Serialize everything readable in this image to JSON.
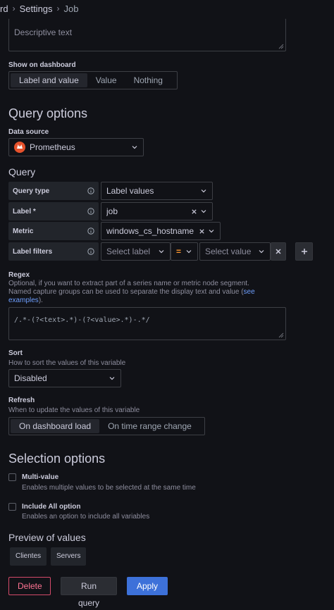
{
  "breadcrumb": {
    "part1": "rd",
    "part2": "Settings",
    "part3": "Job"
  },
  "description": {
    "placeholder": "Descriptive text"
  },
  "show_on_dashboard": {
    "label": "Show on dashboard",
    "options": [
      "Label and value",
      "Value",
      "Nothing"
    ],
    "selected": "Label and value"
  },
  "query_options": {
    "title": "Query options",
    "data_source_label": "Data source",
    "data_source": "Prometheus"
  },
  "query": {
    "title": "Query",
    "rows": [
      {
        "label": "Query type",
        "value": "Label values"
      },
      {
        "label": "Label *",
        "value": "job"
      },
      {
        "label": "Metric",
        "value": "windows_cs_hostname"
      },
      {
        "label": "Label filters"
      }
    ],
    "filter": {
      "label_placeholder": "Select label",
      "operator": "=",
      "value_placeholder": "Select value"
    }
  },
  "regex": {
    "label": "Regex",
    "desc_line1": "Optional, if you want to extract part of a series name or metric node segment.",
    "desc_line2": "Named capture groups can be used to separate the display text and value (",
    "desc_link1": "see",
    "desc_link2": "examples",
    "desc_end": ").",
    "value": "/.*-(?<text>.*)-(?<value>.*)-.*/"
  },
  "sort": {
    "label": "Sort",
    "desc": "How to sort the values of this variable",
    "value": "Disabled"
  },
  "refresh": {
    "label": "Refresh",
    "desc": "When to update the values of this variable",
    "options": [
      "On dashboard load",
      "On time range change"
    ],
    "selected": "On dashboard load"
  },
  "selection_options": {
    "title": "Selection options",
    "multi_value": {
      "label": "Multi-value",
      "desc": "Enables multiple values to be selected at the same time",
      "checked": false
    },
    "include_all": {
      "label": "Include All option",
      "desc": "Enables an option to include all variables",
      "checked": false
    }
  },
  "preview": {
    "title": "Preview of values",
    "values": [
      "Clientes",
      "Servers"
    ]
  },
  "actions": {
    "delete": "Delete",
    "run_query": "Run query",
    "apply": "Apply"
  },
  "colors": {
    "background": "#111217",
    "accent": "#3d71d9",
    "danger": "#d44a6a",
    "operator": "#ff9830",
    "prometheus": "#e6522c"
  }
}
